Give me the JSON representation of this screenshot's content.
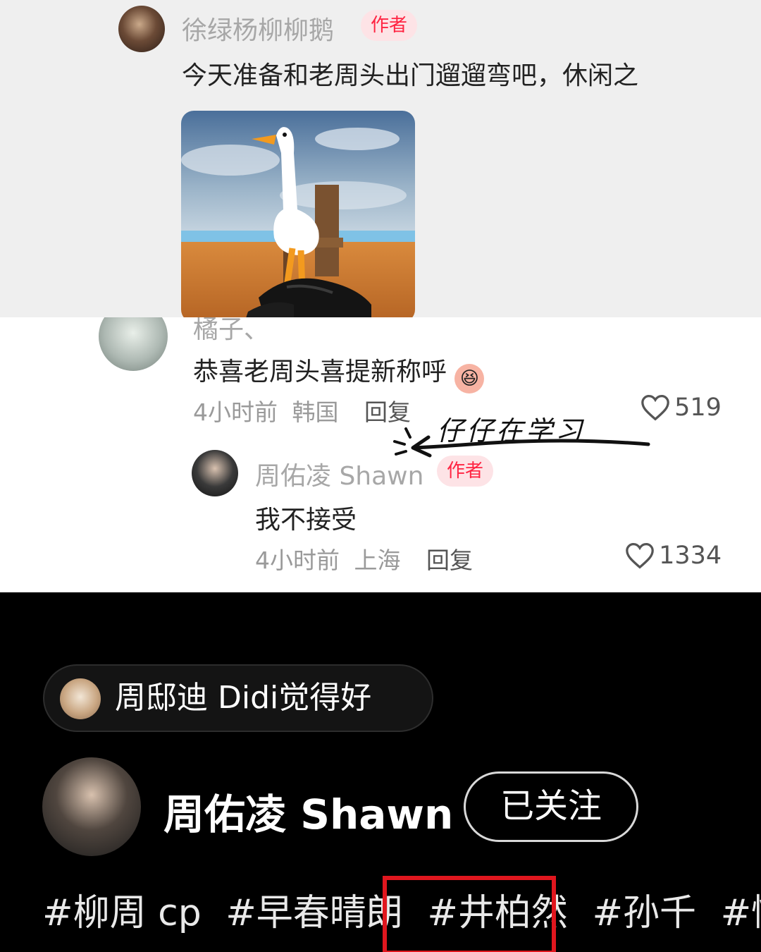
{
  "comment1": {
    "user": "徐绿杨柳柳鹅",
    "author_tag": "作者",
    "text": "今天准备和老周头出门遛遛弯吧，休闲之"
  },
  "comment2": {
    "user": "橘子、",
    "text": "恭喜老周头喜提新称呼",
    "time": "4小时前",
    "location": "韩国",
    "reply_label": "回复",
    "likes": "519"
  },
  "reply1": {
    "user": "周佑凌 Shawn",
    "author_tag": "作者",
    "text": "我不接受",
    "time": "4小时前",
    "location": "上海",
    "reply_label": "回复",
    "likes": "1334"
  },
  "annotation": {
    "handwritten": "仔仔在学习"
  },
  "profile": {
    "liked_by": "周邸迪 Didi觉得好",
    "name": "周佑凌 Shawn",
    "follow_label": "已关注",
    "hashtags": [
      "#柳周 cp",
      "#早春晴朗",
      "#井柏然",
      "#孙千",
      "#情绪"
    ]
  },
  "colors": {
    "accent_red": "#ff2442",
    "highlight_box": "#e0161e"
  },
  "icons": {
    "like": "heart-outline-icon",
    "emoji": "laughing-emoji-icon"
  }
}
